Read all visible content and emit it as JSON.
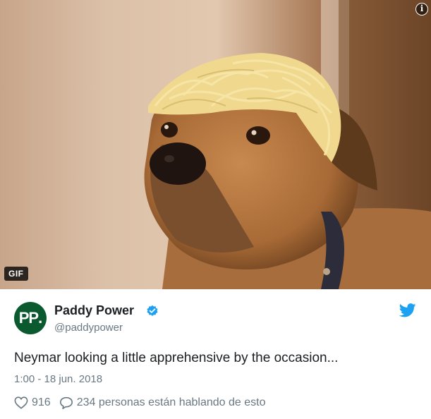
{
  "media": {
    "badge": "GIF",
    "info_icon": "info-icon",
    "subject": "dog-with-spaghetti-on-head"
  },
  "author": {
    "avatar_text": "PP",
    "avatar_color": "#0b5a2f",
    "display_name": "Paddy Power",
    "handle": "@paddypower",
    "verified": true
  },
  "tweet": {
    "text": "Neymar looking a little apprehensive by the occasion...",
    "timestamp": "1:00 - 18 jun. 2018"
  },
  "actions": {
    "likes": "916",
    "replies_text": "234 personas están hablando de esto"
  },
  "colors": {
    "twitter_blue": "#1da1f2",
    "muted": "#697882",
    "text": "#1c2022"
  }
}
